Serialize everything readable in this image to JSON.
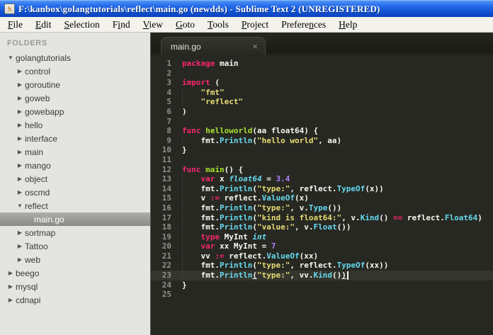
{
  "window": {
    "title": "F:\\kanbox\\golangtutorials\\reflect\\main.go (newdds) - Sublime Text 2 (UNREGISTERED)",
    "icon_glyph": "S"
  },
  "menu": {
    "items": [
      {
        "pre": "",
        "key": "F",
        "post": "ile"
      },
      {
        "pre": "",
        "key": "E",
        "post": "dit"
      },
      {
        "pre": "",
        "key": "S",
        "post": "election"
      },
      {
        "pre": "F",
        "key": "i",
        "post": "nd"
      },
      {
        "pre": "",
        "key": "V",
        "post": "iew"
      },
      {
        "pre": "",
        "key": "G",
        "post": "oto"
      },
      {
        "pre": "",
        "key": "T",
        "post": "ools"
      },
      {
        "pre": "",
        "key": "P",
        "post": "roject"
      },
      {
        "pre": "Prefere",
        "key": "n",
        "post": "ces"
      },
      {
        "pre": "",
        "key": "H",
        "post": "elp"
      }
    ]
  },
  "sidebar": {
    "header": "FOLDERS",
    "tree": [
      {
        "label": "golangtutorials",
        "depth": 0,
        "state": "expanded",
        "selected": false
      },
      {
        "label": "control",
        "depth": 1,
        "state": "collapsed",
        "selected": false
      },
      {
        "label": "goroutine",
        "depth": 1,
        "state": "collapsed",
        "selected": false
      },
      {
        "label": "goweb",
        "depth": 1,
        "state": "collapsed",
        "selected": false
      },
      {
        "label": "gowebapp",
        "depth": 1,
        "state": "collapsed",
        "selected": false
      },
      {
        "label": "hello",
        "depth": 1,
        "state": "collapsed",
        "selected": false
      },
      {
        "label": "interface",
        "depth": 1,
        "state": "collapsed",
        "selected": false
      },
      {
        "label": "main",
        "depth": 1,
        "state": "collapsed",
        "selected": false
      },
      {
        "label": "mango",
        "depth": 1,
        "state": "collapsed",
        "selected": false
      },
      {
        "label": "object",
        "depth": 1,
        "state": "collapsed",
        "selected": false
      },
      {
        "label": "oscmd",
        "depth": 1,
        "state": "collapsed",
        "selected": false
      },
      {
        "label": "reflect",
        "depth": 1,
        "state": "expanded",
        "selected": false
      },
      {
        "label": "main.go",
        "depth": 2,
        "state": "file",
        "selected": true
      },
      {
        "label": "sortmap",
        "depth": 1,
        "state": "collapsed",
        "selected": false
      },
      {
        "label": "Tattoo",
        "depth": 1,
        "state": "collapsed",
        "selected": false
      },
      {
        "label": "web",
        "depth": 1,
        "state": "collapsed",
        "selected": false
      },
      {
        "label": "beego",
        "depth": 0,
        "state": "collapsed",
        "selected": false
      },
      {
        "label": "mysql",
        "depth": 0,
        "state": "collapsed",
        "selected": false
      },
      {
        "label": "cdnapi",
        "depth": 0,
        "state": "collapsed",
        "selected": false
      }
    ],
    "arrow_glyphs": {
      "collapsed": "▶",
      "expanded": "▼"
    }
  },
  "tabs": [
    {
      "label": "main.go",
      "close_glyph": "×",
      "active": true
    }
  ],
  "editor": {
    "colors": {
      "background": "#272822",
      "foreground": "#f8f8f2",
      "keyword": "#f92672",
      "function": "#a6e22e",
      "type": "#66d9ef",
      "string": "#e6db74",
      "number": "#ae81ff",
      "line_number": "#8f908a",
      "current_line": "#34352c",
      "sidebar_bg": "#e4e4e1",
      "titlebar_blue": "#1659d6",
      "menu_bg": "#f4f2ec"
    },
    "lines": [
      {
        "num": 1,
        "indent": 0,
        "tokens": [
          [
            "k",
            "package"
          ],
          [
            "pl",
            " main"
          ]
        ]
      },
      {
        "num": 2,
        "indent": 0,
        "tokens": []
      },
      {
        "num": 3,
        "indent": 0,
        "tokens": [
          [
            "k",
            "import"
          ],
          [
            "pl",
            " ("
          ]
        ]
      },
      {
        "num": 4,
        "indent": 1,
        "tokens": [
          [
            "st",
            "\"fmt\""
          ]
        ]
      },
      {
        "num": 5,
        "indent": 1,
        "tokens": [
          [
            "st",
            "\"reflect\""
          ]
        ]
      },
      {
        "num": 6,
        "indent": 0,
        "tokens": [
          [
            "pl",
            ")"
          ]
        ]
      },
      {
        "num": 7,
        "indent": 0,
        "tokens": []
      },
      {
        "num": 8,
        "indent": 0,
        "tokens": [
          [
            "k",
            "func"
          ],
          [
            "pl",
            " "
          ],
          [
            "fn",
            "helloworld"
          ],
          [
            "pl",
            "(aa float64) {"
          ]
        ]
      },
      {
        "num": 9,
        "indent": 1,
        "tokens": [
          [
            "pl",
            "fmt."
          ],
          [
            "cy",
            "Println"
          ],
          [
            "pl",
            "("
          ],
          [
            "st",
            "\"hello world\""
          ],
          [
            "pl",
            ", aa)"
          ]
        ]
      },
      {
        "num": 10,
        "indent": 0,
        "tokens": [
          [
            "pl",
            "}"
          ]
        ]
      },
      {
        "num": 11,
        "indent": 0,
        "tokens": []
      },
      {
        "num": 12,
        "indent": 0,
        "tokens": [
          [
            "k",
            "func"
          ],
          [
            "pl",
            " "
          ],
          [
            "fn",
            "main"
          ],
          [
            "pl",
            "() {"
          ]
        ]
      },
      {
        "num": 13,
        "indent": 1,
        "tokens": [
          [
            "k",
            "var"
          ],
          [
            "pl",
            " x "
          ],
          [
            "ty",
            "float64"
          ],
          [
            "pl",
            " = "
          ],
          [
            "nu",
            "3.4"
          ]
        ]
      },
      {
        "num": 14,
        "indent": 1,
        "tokens": [
          [
            "pl",
            "fmt."
          ],
          [
            "cy",
            "Println"
          ],
          [
            "pl",
            "("
          ],
          [
            "st",
            "\"type:\""
          ],
          [
            "pl",
            ", reflect."
          ],
          [
            "cy",
            "TypeOf"
          ],
          [
            "pl",
            "(x))"
          ]
        ]
      },
      {
        "num": 15,
        "indent": 1,
        "tokens": [
          [
            "pl",
            "v "
          ],
          [
            "k",
            ":="
          ],
          [
            "pl",
            " reflect."
          ],
          [
            "cy",
            "ValueOf"
          ],
          [
            "pl",
            "(x)"
          ]
        ]
      },
      {
        "num": 16,
        "indent": 1,
        "tokens": [
          [
            "pl",
            "fmt."
          ],
          [
            "cy",
            "Println"
          ],
          [
            "pl",
            "("
          ],
          [
            "st",
            "\"type:\""
          ],
          [
            "pl",
            ", v."
          ],
          [
            "cy",
            "Type"
          ],
          [
            "pl",
            "())"
          ]
        ]
      },
      {
        "num": 17,
        "indent": 1,
        "tokens": [
          [
            "pl",
            "fmt."
          ],
          [
            "cy",
            "Println"
          ],
          [
            "pl",
            "("
          ],
          [
            "st",
            "\"kind is float64:\""
          ],
          [
            "pl",
            ", v."
          ],
          [
            "cy",
            "Kind"
          ],
          [
            "pl",
            "() "
          ],
          [
            "k",
            "=="
          ],
          [
            "pl",
            " reflect."
          ],
          [
            "cy",
            "Float64"
          ],
          [
            "pl",
            ")"
          ]
        ]
      },
      {
        "num": 18,
        "indent": 1,
        "tokens": [
          [
            "pl",
            "fmt."
          ],
          [
            "cy",
            "Println"
          ],
          [
            "pl",
            "("
          ],
          [
            "st",
            "\"value:\""
          ],
          [
            "pl",
            ", v."
          ],
          [
            "cy",
            "Float"
          ],
          [
            "pl",
            "())"
          ]
        ]
      },
      {
        "num": 19,
        "indent": 1,
        "tokens": [
          [
            "k",
            "type"
          ],
          [
            "pl",
            " MyInt "
          ],
          [
            "ty",
            "int"
          ]
        ]
      },
      {
        "num": 20,
        "indent": 1,
        "tokens": [
          [
            "k",
            "var"
          ],
          [
            "pl",
            " xx MyInt = "
          ],
          [
            "nu",
            "7"
          ]
        ]
      },
      {
        "num": 21,
        "indent": 1,
        "tokens": [
          [
            "pl",
            "vv "
          ],
          [
            "k",
            ":="
          ],
          [
            "pl",
            " reflect."
          ],
          [
            "cy",
            "ValueOf"
          ],
          [
            "pl",
            "(xx)"
          ]
        ]
      },
      {
        "num": 22,
        "indent": 1,
        "tokens": [
          [
            "pl",
            "fmt."
          ],
          [
            "cy",
            "Println"
          ],
          [
            "pl",
            "("
          ],
          [
            "st",
            "\"type:\""
          ],
          [
            "pl",
            ", reflect."
          ],
          [
            "cy",
            "TypeOf"
          ],
          [
            "pl",
            "(xx))"
          ]
        ]
      },
      {
        "num": 23,
        "indent": 1,
        "current": true,
        "cursor": true,
        "tokens": [
          [
            "pl",
            "fmt."
          ],
          [
            "cy",
            "Println"
          ],
          [
            "pl u",
            "("
          ],
          [
            "st",
            "\"type:\""
          ],
          [
            "pl",
            ", vv."
          ],
          [
            "cy",
            "Kind"
          ],
          [
            "pl",
            "()"
          ],
          [
            "pl u",
            ")"
          ]
        ]
      },
      {
        "num": 24,
        "indent": 0,
        "tokens": [
          [
            "pl",
            "}"
          ]
        ]
      },
      {
        "num": 25,
        "indent": 0,
        "tokens": []
      }
    ]
  }
}
